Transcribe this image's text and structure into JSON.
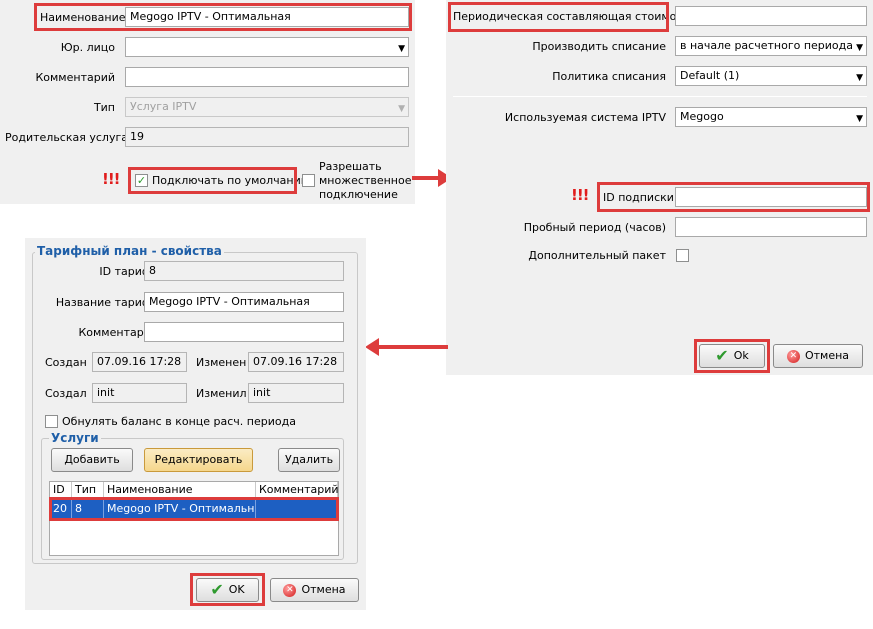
{
  "service_form": {
    "name_label": "Наименование",
    "name_value": "Megogo IPTV - Оптимальная",
    "legal_entity_label": "Юр. лицо",
    "legal_entity_value": "",
    "comment_label": "Комментарий",
    "comment_value": "",
    "type_label": "Тип",
    "type_value": "Услуга IPTV",
    "parent_service_label": "Родительская услуга",
    "parent_service_value": "19",
    "exclamation": "!!!",
    "connect_default_label": "Подключать по умолчанию",
    "connect_default_checked": true,
    "allow_multiple_label_1": "Разрешать",
    "allow_multiple_label_2": "множественное",
    "allow_multiple_label_3": "подключение",
    "allow_multiple_checked": false
  },
  "cost_form": {
    "periodic_cost_label": "Периодическая составляющая стоимости",
    "periodic_cost_value": "",
    "charge_label": "Производить списание",
    "charge_value": "в начале расчетного периода",
    "policy_label": "Политика списания",
    "policy_value": "Default (1)",
    "iptv_system_label": "Используемая система IPTV",
    "iptv_system_value": "Megogo",
    "exclamation": "!!!",
    "subscription_id_label": "ID подписки",
    "subscription_id_value": "",
    "trial_label": "Пробный период (часов)",
    "trial_value": "",
    "extra_package_label": "Дополнительный пакет",
    "extra_package_checked": false,
    "ok_label": "Ok",
    "cancel_label": "Отмена"
  },
  "tariff_form": {
    "group_title": "Тарифный план - свойства",
    "tariff_id_label": "ID тарифа",
    "tariff_id_value": "8",
    "tariff_name_label": "Название тарифа",
    "tariff_name_value": "Megogo IPTV - Оптимальная",
    "comments_label": "Комментарии",
    "comments_value": "",
    "created_label": "Создан",
    "created_value": "07.09.16 17:28",
    "modified_label": "Изменен",
    "modified_value": "07.09.16 17:28",
    "creator_label": "Создал",
    "creator_value": "init",
    "modifier_label": "Изменил",
    "modifier_value": "init",
    "reset_balance_label": "Обнулять баланс в конце расч. периода",
    "reset_balance_checked": false,
    "services_group_title": "Услуги",
    "add_label": "Добавить",
    "edit_label": "Редактировать",
    "delete_label": "Удалить",
    "table": {
      "headers": [
        "ID",
        "Тип",
        "Наименование",
        "Комментарий"
      ],
      "rows": [
        [
          "20",
          "8",
          "Megogo IPTV - Оптимальная",
          ""
        ]
      ]
    },
    "ok_label": "OK",
    "cancel_label": "Отмена"
  },
  "icons": {
    "ok": "checkmark-icon",
    "cancel": "cancel-icon",
    "dropdown": "chevron-down-icon",
    "arrow_right": "arrow-right-icon",
    "arrow_left": "arrow-left-icon"
  },
  "colors": {
    "highlight_border": "#dd3c3c",
    "exclamation": "#e11c1c",
    "group_title": "#1f5fa8",
    "selected_row": "#1d5fc2"
  }
}
